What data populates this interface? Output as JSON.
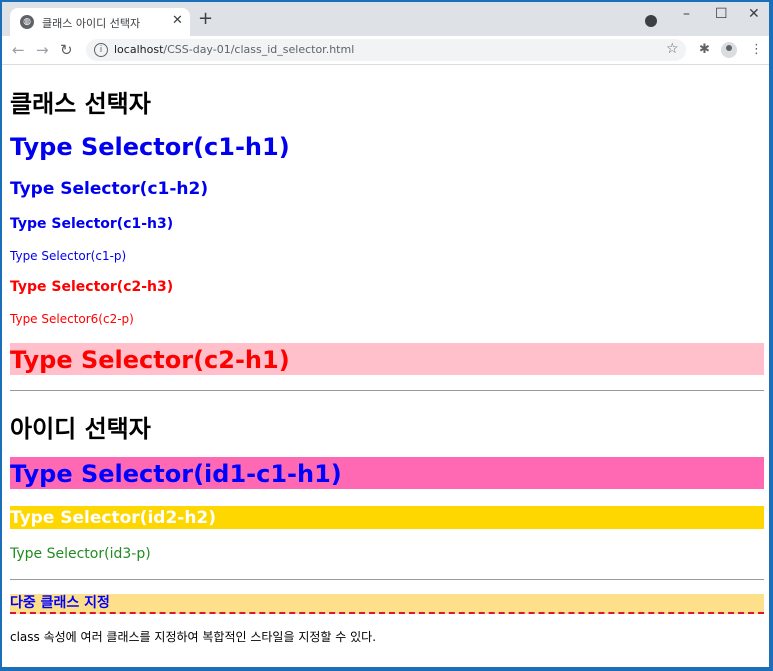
{
  "browser": {
    "tab_title": "클래스 아이디 선택자",
    "url_host": "localhost",
    "url_path": "/CSS-day-01/class_id_selector.html",
    "colors": {
      "tabbar": "#dee1e6",
      "window_border": "#1b6fb8"
    }
  },
  "page": {
    "heading_class": "클래스 선택자",
    "c1_h1": "Type Selector(c1-h1)",
    "c1_h2": "Type Selector(c1-h2)",
    "c1_h3": "Type Selector(c1-h3)",
    "c1_p": "Type Selector(c1-p)",
    "c2_h3": "Type Selector(c2-h3)",
    "c2_p": "Type Selector6(c2-p)",
    "c2_h1": "Type Selector(c2-h1)",
    "heading_id": "아이디 선택자",
    "id1_h1": "Type Selector(id1-c1-h1)",
    "id2_h2": "Type Selector(id2-h2)",
    "id3_p": "Type Selector(id3-p)",
    "multi_heading": "다중 클래스 지정",
    "multi_desc": "class 속성에 여러 클래스를 지정하여 복합적인 스타일을 지정할 수 있다.",
    "colors": {
      "c1": "#0000ee",
      "c2": "#ff0000",
      "c2_h1_bg": "#ffc0cb",
      "id1_bg": "#ff69b4",
      "id2_bg": "#ffd700",
      "id3": "#228b22",
      "multi_bg": "#ffe08a",
      "multi_border": "#dc143c"
    }
  }
}
